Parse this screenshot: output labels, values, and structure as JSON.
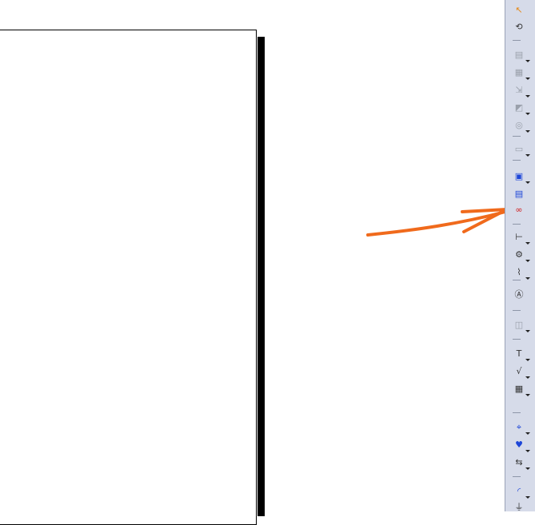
{
  "annotation": {
    "color": "#f06a1c"
  },
  "toolbar": {
    "tools": [
      {
        "name": "select-icon",
        "glyph": "↖",
        "style": "orange",
        "caret": false
      },
      {
        "name": "fly-view-icon",
        "glyph": "⟲",
        "style": "dark",
        "caret": false
      },
      {
        "name": "frame-view-icon",
        "glyph": "▤",
        "style": "dim",
        "caret": true
      },
      {
        "name": "sheet-background-icon",
        "glyph": "▦",
        "style": "dim",
        "caret": true
      },
      {
        "name": "projection-icon",
        "glyph": "⇲",
        "style": "dim",
        "caret": true
      },
      {
        "name": "section-view-icon",
        "glyph": "◩",
        "style": "dim",
        "caret": true
      },
      {
        "name": "detail-view-icon",
        "glyph": "◎",
        "style": "dim",
        "caret": true
      },
      {
        "name": "clipping-view-icon",
        "glyph": "▭",
        "style": "dim",
        "caret": true
      },
      {
        "name": "view-frame-icon",
        "glyph": "▣",
        "style": "blue",
        "caret": true
      },
      {
        "name": "generate-view-icon",
        "glyph": "▤",
        "style": "blue",
        "caret": false
      },
      {
        "name": "links-icon",
        "glyph": "∞",
        "style": "red",
        "caret": false
      },
      {
        "name": "dimension-icon",
        "glyph": "⊢",
        "style": "dark",
        "caret": true
      },
      {
        "name": "dimension-settings-icon",
        "glyph": "⚙",
        "style": "dark",
        "caret": true
      },
      {
        "name": "tolerance-icon",
        "glyph": "⌇",
        "style": "dark",
        "caret": true
      },
      {
        "name": "datum-frame-icon",
        "glyph": "Ⓐ",
        "style": "dark",
        "caret": false
      },
      {
        "name": "annotation-tool-icon",
        "glyph": "◫",
        "style": "dim",
        "caret": true
      },
      {
        "name": "text-icon",
        "glyph": "T",
        "style": "dark",
        "caret": true
      },
      {
        "name": "roughness-icon",
        "glyph": "√",
        "style": "dark",
        "caret": true
      },
      {
        "name": "table-icon",
        "glyph": "▦",
        "style": "dark",
        "caret": true
      },
      {
        "name": "point-icon",
        "glyph": "⌖",
        "style": "blue",
        "caret": true
      },
      {
        "name": "axis-icon",
        "glyph": "♥",
        "style": "blue",
        "caret": true
      },
      {
        "name": "transfer-icon",
        "glyph": "⇆",
        "style": "dark",
        "caret": true
      },
      {
        "name": "arc-icon",
        "glyph": "◜",
        "style": "blue",
        "caret": true
      },
      {
        "name": "dress-up-icon",
        "glyph": "⏚",
        "style": "dark",
        "caret": false
      }
    ]
  }
}
